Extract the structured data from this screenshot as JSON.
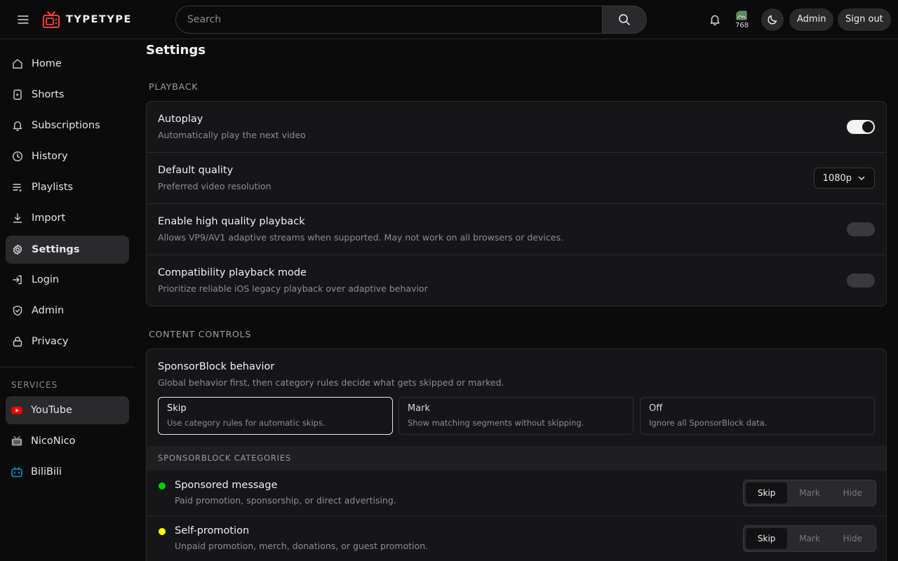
{
  "header": {
    "brand": "TYPETYPE",
    "search_placeholder": "Search",
    "avatar_alt": "768",
    "admin_label": "Admin",
    "signout_label": "Sign out"
  },
  "sidebar": {
    "items": [
      {
        "label": "Home",
        "icon": "home-icon"
      },
      {
        "label": "Shorts",
        "icon": "shorts-icon"
      },
      {
        "label": "Subscriptions",
        "icon": "bell-icon"
      },
      {
        "label": "History",
        "icon": "clock-icon"
      },
      {
        "label": "Playlists",
        "icon": "playlist-icon"
      },
      {
        "label": "Import",
        "icon": "download-icon"
      },
      {
        "label": "Settings",
        "icon": "gear-icon",
        "active": true
      },
      {
        "label": "Login",
        "icon": "login-icon"
      },
      {
        "label": "Admin",
        "icon": "shield-icon"
      },
      {
        "label": "Privacy",
        "icon": "lock-icon"
      }
    ],
    "services_label": "SERVICES",
    "services": [
      {
        "label": "YouTube",
        "icon": "youtube-icon",
        "color": "#ff0000",
        "active": true
      },
      {
        "label": "NicoNico",
        "icon": "niconico-icon",
        "color": "#a0a0a4"
      },
      {
        "label": "BiliBili",
        "icon": "bilibili-icon",
        "color": "#00a1d6"
      }
    ]
  },
  "main": {
    "title": "Settings",
    "playback": {
      "label": "PLAYBACK",
      "rows": [
        {
          "title": "Autoplay",
          "desc": "Automatically play the next video",
          "control": "toggle",
          "on": true
        },
        {
          "title": "Default quality",
          "desc": "Preferred video resolution",
          "control": "select",
          "value": "1080p"
        },
        {
          "title": "Enable high quality playback",
          "desc": "Allows VP9/AV1 adaptive streams when supported. May not work on all browsers or devices.",
          "control": "toggle",
          "on": false
        },
        {
          "title": "Compatibility playback mode",
          "desc": "Prioritize reliable iOS legacy playback over adaptive behavior",
          "control": "toggle",
          "on": false
        }
      ]
    },
    "content_controls": {
      "label": "CONTENT CONTROLS",
      "sponsorblock_title": "SponsorBlock behavior",
      "sponsorblock_desc": "Global behavior first, then category rules decide what gets skipped or marked.",
      "options": [
        {
          "title": "Skip",
          "desc": "Use category rules for automatic skips.",
          "selected": true
        },
        {
          "title": "Mark",
          "desc": "Show matching segments without skipping."
        },
        {
          "title": "Off",
          "desc": "Ignore all SponsorBlock data."
        }
      ],
      "categories_label": "SPONSORBLOCK CATEGORIES",
      "segment_labels": [
        "Skip",
        "Mark",
        "Hide"
      ],
      "categories": [
        {
          "title": "Sponsored message",
          "desc": "Paid promotion, sponsorship, or direct advertising.",
          "color": "#00d400",
          "selected": "Skip"
        },
        {
          "title": "Self-promotion",
          "desc": "Unpaid promotion, merch, donations, or guest promotion.",
          "color": "#ffff00",
          "selected": "Skip"
        }
      ]
    }
  }
}
